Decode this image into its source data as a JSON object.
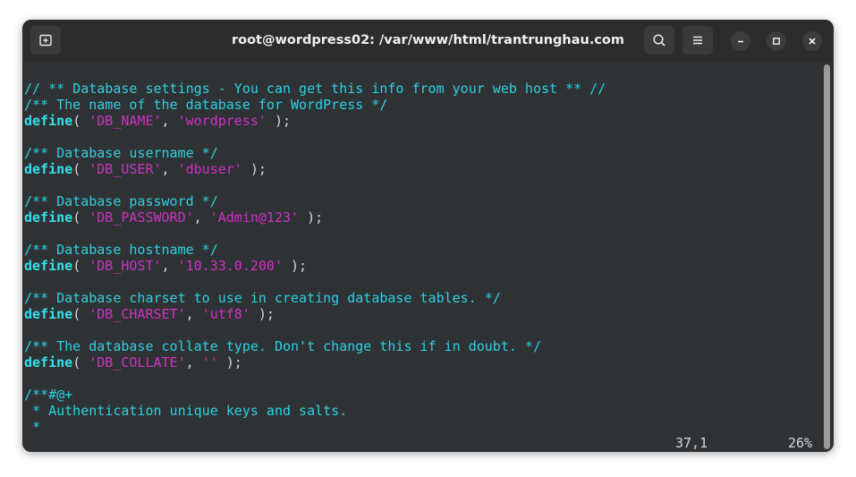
{
  "window": {
    "title": "root@wordpress02: /var/www/html/trantrunghau.com",
    "controls": {
      "new_tab_icon": "new-tab-icon",
      "search_icon": "search-icon",
      "menu_icon": "hamburger-menu-icon",
      "minimize_icon": "minimize-icon",
      "maximize_icon": "maximize-icon",
      "close_icon": "close-icon"
    }
  },
  "colors": {
    "comment": "#2bd1e3",
    "keyword": "#30e2ee",
    "string": "#d12fc8",
    "background": "#2f3234"
  },
  "editor": {
    "lines": [
      [
        {
          "t": "comment",
          "v": "// ** Database settings - You can get this info from your web host ** //"
        }
      ],
      [
        {
          "t": "comment",
          "v": "/** The name of the database for WordPress */"
        }
      ],
      [
        {
          "t": "kw",
          "v": "define"
        },
        {
          "t": "plain",
          "v": "( "
        },
        {
          "t": "str",
          "v": "'DB_NAME'"
        },
        {
          "t": "plain",
          "v": ", "
        },
        {
          "t": "str",
          "v": "'wordpress'"
        },
        {
          "t": "plain",
          "v": " );"
        }
      ],
      [],
      [
        {
          "t": "comment",
          "v": "/** Database username */"
        }
      ],
      [
        {
          "t": "kw",
          "v": "define"
        },
        {
          "t": "plain",
          "v": "( "
        },
        {
          "t": "str",
          "v": "'DB_USER'"
        },
        {
          "t": "plain",
          "v": ", "
        },
        {
          "t": "str",
          "v": "'dbuser'"
        },
        {
          "t": "plain",
          "v": " );"
        }
      ],
      [],
      [
        {
          "t": "comment",
          "v": "/** Database password */"
        }
      ],
      [
        {
          "t": "kw",
          "v": "define"
        },
        {
          "t": "plain",
          "v": "( "
        },
        {
          "t": "str",
          "v": "'DB_PASSWORD'"
        },
        {
          "t": "plain",
          "v": ", "
        },
        {
          "t": "str",
          "v": "'Admin@123'"
        },
        {
          "t": "plain",
          "v": " );"
        }
      ],
      [],
      [
        {
          "t": "comment",
          "v": "/** Database hostname */"
        }
      ],
      [
        {
          "t": "kw",
          "v": "define"
        },
        {
          "t": "plain",
          "v": "( "
        },
        {
          "t": "str",
          "v": "'DB_HOST'"
        },
        {
          "t": "plain",
          "v": ", "
        },
        {
          "t": "str",
          "v": "'10.33.0.200'"
        },
        {
          "t": "plain",
          "v": " );"
        }
      ],
      [],
      [
        {
          "t": "comment",
          "v": "/** Database charset to use in creating database tables. */"
        }
      ],
      [
        {
          "t": "kw",
          "v": "define"
        },
        {
          "t": "plain",
          "v": "( "
        },
        {
          "t": "str",
          "v": "'DB_CHARSET'"
        },
        {
          "t": "plain",
          "v": ", "
        },
        {
          "t": "str",
          "v": "'utf8'"
        },
        {
          "t": "plain",
          "v": " );"
        }
      ],
      [],
      [
        {
          "t": "comment",
          "v": "/** The database collate type. Don't change this if in doubt. */"
        }
      ],
      [
        {
          "t": "kw",
          "v": "define"
        },
        {
          "t": "plain",
          "v": "( "
        },
        {
          "t": "str",
          "v": "'DB_COLLATE'"
        },
        {
          "t": "plain",
          "v": ", "
        },
        {
          "t": "str",
          "v": "''"
        },
        {
          "t": "plain",
          "v": " );"
        }
      ],
      [],
      [
        {
          "t": "comment",
          "v": "/**#@+"
        }
      ],
      [
        {
          "t": "comment",
          "v": " * Authentication unique keys and salts."
        }
      ],
      [
        {
          "t": "comment",
          "v": " *"
        }
      ]
    ]
  },
  "statusbar": {
    "cursor": "37,1",
    "percent": "26%"
  }
}
